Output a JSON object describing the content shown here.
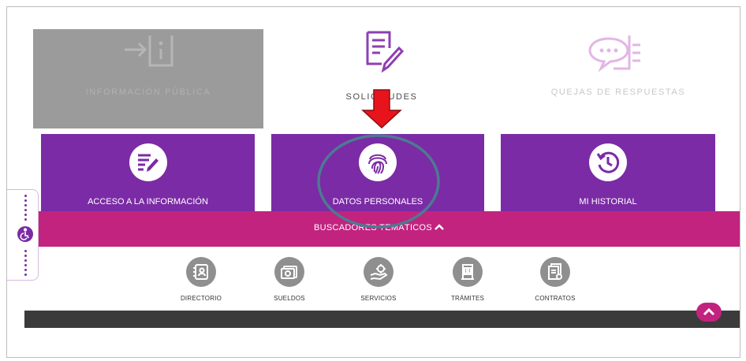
{
  "top_cards": [
    {
      "label": "INFORMACIÓN PÚBLICA",
      "icon": "info-arrow-icon"
    },
    {
      "label": "SOLICITUDES",
      "icon": "document-pencil-icon"
    },
    {
      "label": "QUEJAS DE RESPUESTAS",
      "icon": "chat-list-icon"
    }
  ],
  "purple_cards": [
    {
      "label": "ACCESO A LA INFORMACIÓN",
      "icon": "list-pencil-icon"
    },
    {
      "label": "DATOS PERSONALES",
      "icon": "fingerprint-icon"
    },
    {
      "label": "MI HISTORIAL",
      "icon": "history-icon"
    }
  ],
  "search_bar": {
    "label": "BUSCADORES TEMÁTICOS"
  },
  "thematic_icons": [
    {
      "label": "DIRECTORIO",
      "icon": "contacts-icon"
    },
    {
      "label": "SUELDOS",
      "icon": "money-icon"
    },
    {
      "label": "SERVICIOS",
      "icon": "hand-gear-icon"
    },
    {
      "label": "TRÁMITES",
      "icon": "id-card-icon"
    },
    {
      "label": "CONTRATOS",
      "icon": "contract-icon"
    }
  ],
  "colors": {
    "purple": "#7b2ba5",
    "magenta": "#c2237f",
    "annotation_arrow": "#e8141c",
    "annotation_circle": "#4c7a92"
  }
}
